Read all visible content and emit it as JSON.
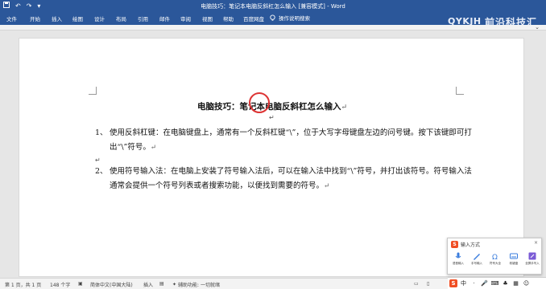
{
  "window": {
    "title": "电脑技巧：笔记本电脑反斜杠怎么输入 [兼容模式] - Word"
  },
  "quick_access": {
    "save_icon": "save-icon",
    "undo_icon": "undo-icon",
    "redo_icon": "redo-icon",
    "customize_icon": "customize-icon"
  },
  "tabs": [
    "文件",
    "开始",
    "插入",
    "绘图",
    "设计",
    "布局",
    "引用",
    "邮件",
    "审阅",
    "视图",
    "帮助",
    "百度网盘"
  ],
  "tell_me": {
    "label": "操作说明搜索"
  },
  "watermark": {
    "brand_en": "QYKJH",
    "brand_cn": "前沿科技汇",
    "brand_sub": "FRONTIER TECHNOLOGY COLLECTION"
  },
  "document": {
    "title": "电脑技巧：笔记本电脑反斜杠怎么输入",
    "paragraph_mark": "↵",
    "items": [
      {
        "num": "1、",
        "text": "使用反斜杠键：在电脑键盘上，通常有一个反斜杠键“\\”，位于大写字母键盘左边的问号键。按下该键即可打出“\\”符号。"
      },
      {
        "num": "2、",
        "text": "使用符号输入法：在电脑上安装了符号输入法后，可以在输入法中找到“\\”符号，并打出该符号。符号输入法通常会提供一个符号列表或者搜索功能，以便找到需要的符号。"
      }
    ]
  },
  "statusbar": {
    "page": "第 1 页，共 1 页",
    "words": "148 个字",
    "language": "简体中文(中国大陆)",
    "mode": "插入",
    "accessibility": "辅助功能: 一切就绪"
  },
  "ime_panel": {
    "title": "输入方式",
    "items": [
      "语音输入",
      "手写输入",
      "符号大全",
      "软键盘",
      "全屏手写入"
    ]
  },
  "ime_bar": {
    "lang": "中",
    "extra": "·"
  },
  "colors": {
    "accent": "#2b579a",
    "circle": "#dd3333",
    "ime_brand": "#f04e23"
  }
}
